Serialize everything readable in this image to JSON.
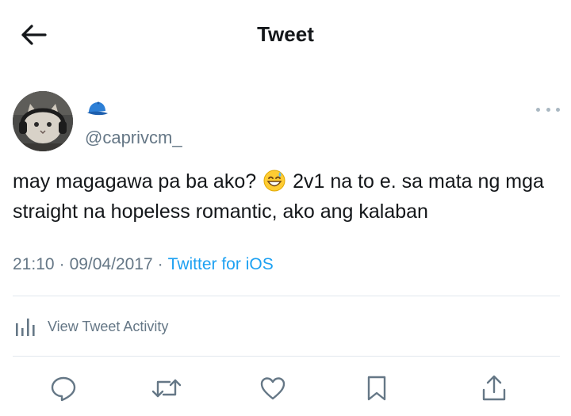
{
  "header": {
    "title": "Tweet",
    "back_icon": "arrow-left-icon"
  },
  "author": {
    "handle": "@caprivcm_",
    "badge_icon": "blue-cap-emoji",
    "avatar": "cat-with-headphones-avatar"
  },
  "tweet": {
    "text_before_emoji": "may magagawa pa ba ako?",
    "emoji": "grinning-face-with-sweat-emoji",
    "text_after_emoji": "2v1 na to e. sa mata ng mga straight na hopeless romantic, ako ang kalaban"
  },
  "meta": {
    "time": "21:10",
    "separator": "·",
    "date": "09/04/2017",
    "source": "Twitter for iOS"
  },
  "activity": {
    "label": "View Tweet Activity",
    "icon": "bar-chart-icon"
  },
  "actions": [
    {
      "name": "reply",
      "icon": "reply-icon"
    },
    {
      "name": "retweet",
      "icon": "retweet-icon"
    },
    {
      "name": "like",
      "icon": "heart-icon"
    },
    {
      "name": "bookmark",
      "icon": "bookmark-icon"
    },
    {
      "name": "share",
      "icon": "share-icon"
    }
  ],
  "colors": {
    "text": "#14171a",
    "secondary": "#657786",
    "link": "#1da1f2",
    "divider": "#e1e8ed"
  }
}
